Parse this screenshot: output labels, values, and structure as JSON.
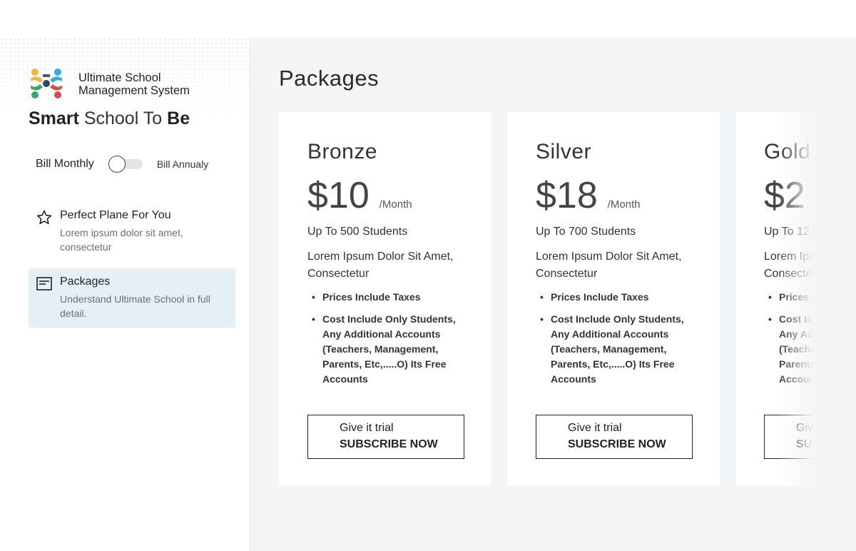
{
  "brand": {
    "name_line1": "Ultimate School",
    "name_line2": "Management System",
    "tagline": {
      "part1": "Smart",
      "part2": "School",
      "part3": "To",
      "part4": "Be"
    },
    "logo_icon": "people-circle-logo-icon"
  },
  "billing": {
    "monthly_label": "Bill Monthly",
    "annual_label": "Bill Annualy",
    "is_annual": false
  },
  "sidebar": {
    "items": [
      {
        "icon": "star-icon",
        "title": "Perfect Plane For You",
        "description": "Lorem ipsum dolor sit amet, consectetur",
        "active": false
      },
      {
        "icon": "document-icon",
        "title": "Packages",
        "description": "Understand Ultimate School in full detail.",
        "active": true
      }
    ]
  },
  "main": {
    "title": "Packages"
  },
  "packages": [
    {
      "name": "Bronze",
      "price": "$10",
      "period": "/Month",
      "students": "Up To 500 Students",
      "description": "Lorem Ipsum Dolor Sit Amet, Consectetur",
      "features": [
        "Prices Include Taxes",
        "Cost Include Only Students, Any Additional Accounts (Teachers, Management, Parents, Etc,.....O) Its Free Accounts"
      ],
      "cta_top": "Give it trial",
      "cta_bottom": "SUBSCRIBE NOW"
    },
    {
      "name": "Silver",
      "price": "$18",
      "period": "/Month",
      "students": "Up To 700 Students",
      "description": "Lorem Ipsum Dolor Sit Amet, Consectetur",
      "features": [
        "Prices Include Taxes",
        "Cost Include Only Students, Any Additional Accounts (Teachers, Management, Parents, Etc,.....O) Its Free Accounts"
      ],
      "cta_top": "Give it trial",
      "cta_bottom": "SUBSCRIBE NOW"
    },
    {
      "name": "Gold",
      "price": "$2",
      "period": "",
      "students": "Up To 12",
      "description": "Lorem Ipsum Dolor Sit Amet, Consectetur",
      "features": [
        "Prices Include Taxes",
        "Cost Include Only Students, Any Additional Accounts (Teachers, Management, Parents, Etc,.....O) Its Free Accounts"
      ],
      "cta_top": "Give it trial",
      "cta_bottom": "SUBSCRIBE NOW"
    }
  ],
  "colors": {
    "main_bg": "#f4f5f7",
    "active_nav_bg": "#e4eff6",
    "logo_yellow": "#f4b93c",
    "logo_blue": "#3aa9dc",
    "logo_red": "#d94a4a",
    "logo_green": "#3aa66a"
  }
}
